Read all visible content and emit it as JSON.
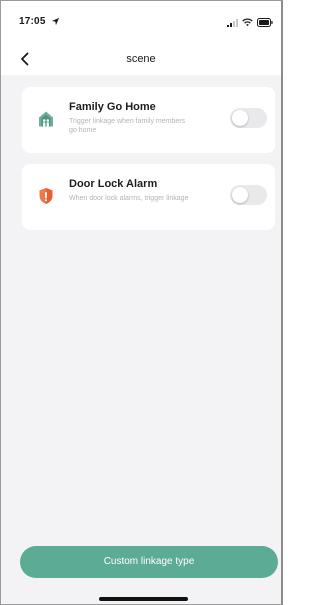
{
  "status_bar": {
    "time": "17:05"
  },
  "nav": {
    "title": "scene"
  },
  "scenes": [
    {
      "title": "Family Go Home",
      "description": "Trigger linkage when family members go home",
      "icon": "home-icon",
      "icon_color": "#6fb09a",
      "enabled": false
    },
    {
      "title": "Door Lock Alarm",
      "description": "When door lock alarms, trigger linkage",
      "icon": "shield-icon",
      "icon_color": "#f07748",
      "enabled": false
    }
  ],
  "footer": {
    "custom_button_label": "Custom linkage type",
    "accent_color": "#5cab95"
  }
}
